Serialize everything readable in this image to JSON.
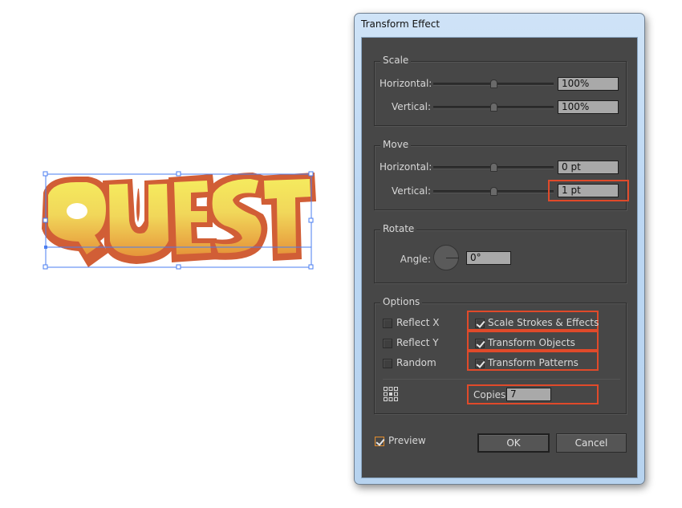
{
  "artwork": {
    "text": "QUEST",
    "colors": {
      "fill_top": "#f5ea5e",
      "fill_bottom": "#e79a3a",
      "outline": "#d15e36",
      "selection": "#4a7df0"
    }
  },
  "dialog": {
    "title": "Transform Effect",
    "scale": {
      "label": "Scale",
      "horizontal_label": "Horizontal:",
      "horizontal_value": "100%",
      "horizontal_slider": 0.5,
      "vertical_label": "Vertical:",
      "vertical_value": "100%",
      "vertical_slider": 0.5
    },
    "move": {
      "label": "Move",
      "horizontal_label": "Horizontal:",
      "horizontal_value": "0 pt",
      "horizontal_slider": 0.5,
      "vertical_label": "Vertical:",
      "vertical_value": "1 pt",
      "vertical_slider": 0.5
    },
    "rotate": {
      "label": "Rotate",
      "angle_label": "Angle:",
      "angle_value": "0°"
    },
    "options": {
      "label": "Options",
      "reflect_x": {
        "label": "Reflect X",
        "checked": false
      },
      "reflect_y": {
        "label": "Reflect Y",
        "checked": false
      },
      "random": {
        "label": "Random",
        "checked": false
      },
      "scale_strokes": {
        "label": "Scale Strokes & Effects",
        "checked": true
      },
      "transform_objects": {
        "label": "Transform Objects",
        "checked": true
      },
      "transform_patterns": {
        "label": "Transform Patterns",
        "checked": true
      },
      "copies_label": "Copies",
      "copies_value": "7",
      "reference_point_icon": "reference-point-grid"
    },
    "preview": {
      "label": "Preview",
      "checked": true
    },
    "ok_label": "OK",
    "cancel_label": "Cancel",
    "highlight_color": "#e04a2a"
  }
}
